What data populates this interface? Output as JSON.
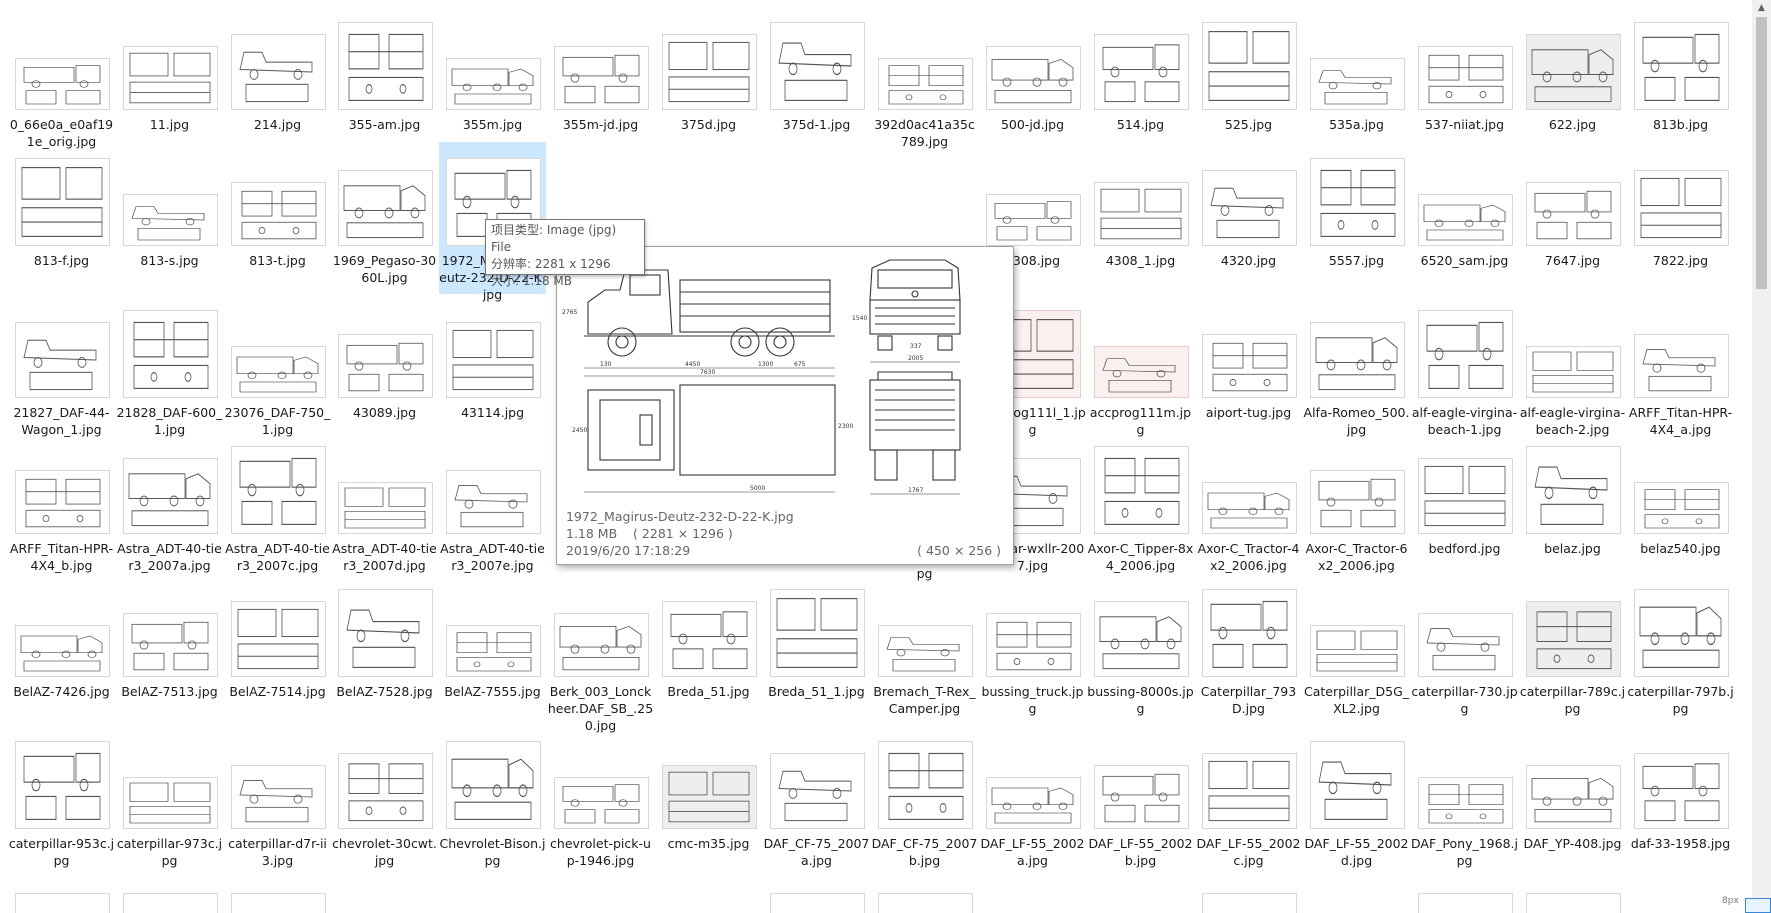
{
  "grid": {
    "rows": [
      [
        "0_66e0a_e0af191e_orig.jpg",
        "11.jpg",
        "214.jpg",
        "355-am.jpg",
        "355m.jpg",
        "355m-jd.jpg",
        "375d.jpg",
        "375d-1.jpg",
        "392d0ac41a35c789.jpg",
        "500-jd.jpg",
        "514.jpg",
        "525.jpg",
        "535a.jpg",
        "537-niiat.jpg",
        "622.jpg",
        "813b.jpg"
      ],
      [
        "813-f.jpg",
        "813-s.jpg",
        "813-t.jpg",
        "1969_Pegaso-3060L.jpg",
        "1972_Magirus-Deutz-232-D-22-K.jpg",
        "",
        "",
        "",
        "",
        "4308.jpg",
        "4308_1.jpg",
        "4320.jpg",
        "5557.jpg",
        "6520_sam.jpg",
        "7647.jpg",
        "7822.jpg"
      ],
      [
        "21827_DAF-44-Wagon_1.jpg",
        "21828_DAF-600_1.jpg",
        "23076_DAF-750_1.jpg",
        "43089.jpg",
        "43114.jpg",
        "",
        "",
        "",
        "",
        "accprog111l_1.jpg",
        "accprog111m.jpg",
        "aiport-tug.jpg",
        "Alfa-Romeo_500.jpg",
        "alf-eagle-virgina-beach-1.jpg",
        "alf-eagle-virgina-beach-2.jpg",
        "ARFF_Titan-HPR-4X4_a.jpg"
      ],
      [
        "ARFF_Titan-HPR-4X4_b.jpg",
        "Astra_ADT-40-tier3_2007a.jpg",
        "Astra_ADT-40-tier3_2007c.jpg",
        "Astra_ADT-40-tier3_2007d.jpg",
        "Astra_ADT-40-tier3_2007e.jpg",
        "",
        "",
        "",
        "",
        "avocar-wxllr-2007.jpg",
        "Axor-C_Tipper-8x4_2006.jpg",
        "Axor-C_Tractor-4x2_2006.jpg",
        "Axor-C_Tractor-6x2_2006.jpg",
        "bedford.jpg",
        "belaz.jpg",
        "belaz540.jpg"
      ],
      [
        "BelAZ-7426.jpg",
        "BelAZ-7513.jpg",
        "BelAZ-7514.jpg",
        "BelAZ-7528.jpg",
        "BelAZ-7555.jpg",
        "Berk_003_Lonckheer.DAF_SB_.250.jpg",
        "Breda_51.jpg",
        "Breda_51_1.jpg",
        "Bremach_T-Rex_Camper.jpg",
        "bussing_truck.jpg",
        "bussing-8000s.jpg",
        "Caterpillar_793D.jpg",
        "Caterpillar_D5G_XL2.jpg",
        "caterpillar-730.jpg",
        "caterpillar-789c.jpg",
        "caterpillar-797b.jpg"
      ],
      [
        "caterpillar-953c.jpg",
        "caterpillar-973c.jpg",
        "caterpillar-d7r-ii3.jpg",
        "chevrolet-30cwt.jpg",
        "Chevrolet-Bison.jpg",
        "chevrolet-pick-up-1946.jpg",
        "cmc-m35.jpg",
        "DAF_CF-75_2007a.jpg",
        "DAF_CF-75_2007b.jpg",
        "DAF_LF-55_2002a.jpg",
        "DAF_LF-55_2002b.jpg",
        "DAF_LF-55_2002c.jpg",
        "DAF_LF-55_2002d.jpg",
        "DAF_Pony_1968.jpg",
        "DAF_YP-408.jpg",
        "daf-33-1958.jpg"
      ]
    ],
    "row3_col8_fragment": "pg"
  },
  "tooltip": {
    "type_line": "项目类型: Image (jpg) File",
    "resolution_line": "分辨率: 2281 x 1296",
    "size_line": "大小: 1.18 MB"
  },
  "preview": {
    "filename": "1972_Magirus-Deutz-232-D-22-K.jpg",
    "size_info": "1.18 MB    ( 2281 × 1296 )",
    "date": "2019/6/20 17:18:29",
    "thumb_dims": "( 450 × 256 )",
    "drawing_dims": [
      "2765",
      "4450",
      "1300",
      "675",
      "7630",
      "130",
      "2450",
      "5000",
      "2300",
      "2005",
      "1540",
      "337",
      "1767"
    ]
  },
  "colors": {
    "selection": "#cce8ff",
    "border": "#d7d7d7",
    "scroll_thumb": "#c1c1c1"
  },
  "scrollbar": {
    "up_icon": "▲"
  },
  "corner": {
    "text": "8px"
  }
}
